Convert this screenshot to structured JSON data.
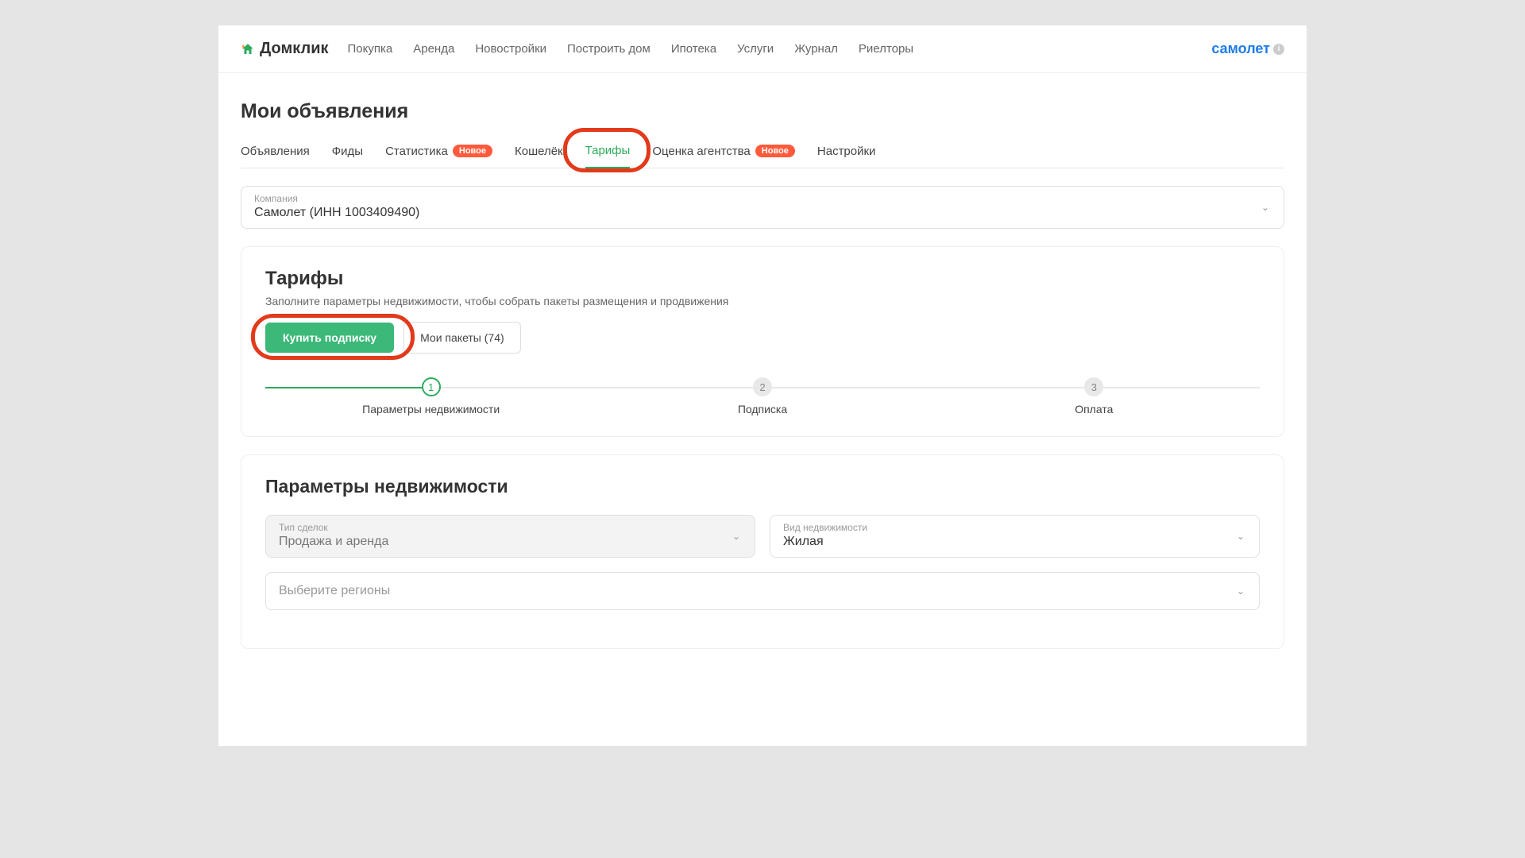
{
  "header": {
    "logo_text": "Домклик",
    "nav": [
      "Покупка",
      "Аренда",
      "Новостройки",
      "Построить дом",
      "Ипотека",
      "Услуги",
      "Журнал",
      "Риелторы"
    ],
    "brand_right": "самолет"
  },
  "page": {
    "title": "Мои объявления"
  },
  "tabs": {
    "items": [
      {
        "label": "Объявления",
        "badge": null,
        "active": false
      },
      {
        "label": "Фиды",
        "badge": null,
        "active": false
      },
      {
        "label": "Статистика",
        "badge": "Новое",
        "active": false
      },
      {
        "label": "Кошелёк",
        "badge": null,
        "active": false
      },
      {
        "label": "Тарифы",
        "badge": null,
        "active": true
      },
      {
        "label": "Оценка агентства",
        "badge": "Новое",
        "active": false
      },
      {
        "label": "Настройки",
        "badge": null,
        "active": false
      }
    ]
  },
  "company": {
    "label": "Компания",
    "value": "Самолет (ИНН 1003409490)"
  },
  "tariffs": {
    "title": "Тарифы",
    "desc": "Заполните параметры недвижимости, чтобы собрать пакеты размещения и продвижения",
    "buy_label": "Купить подписку",
    "my_packages_label": "Мои пакеты (74)",
    "steps": [
      {
        "num": "1",
        "label": "Параметры недвижимости",
        "active": true
      },
      {
        "num": "2",
        "label": "Подписка",
        "active": false
      },
      {
        "num": "3",
        "label": "Оплата",
        "active": false
      }
    ]
  },
  "params": {
    "title": "Параметры недвижимости",
    "deal_type": {
      "label": "Тип сделок",
      "value": "Продажа и аренда"
    },
    "property_type": {
      "label": "Вид недвижимости",
      "value": "Жилая"
    },
    "region": {
      "placeholder": "Выберите регионы"
    }
  }
}
